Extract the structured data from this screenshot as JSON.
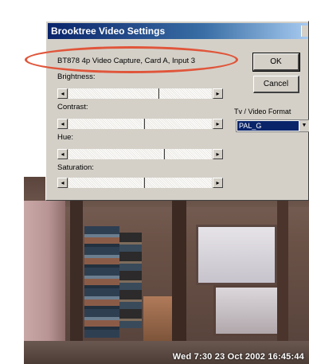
{
  "dialog": {
    "title": "Brooktree Video Settings",
    "device": "BT878 4p Video Capture, Card A, Input 3",
    "ok_label": "OK",
    "cancel_label": "Cancel",
    "format_label": "Tv / Video Format",
    "format_value": "PAL_G",
    "sliders": [
      {
        "label": "Brightness:",
        "value": 0.62
      },
      {
        "label": "Contrast:",
        "value": 0.52
      },
      {
        "label": "Hue:",
        "value": 0.66
      },
      {
        "label": "Saturation:",
        "value": 0.52
      }
    ]
  },
  "video": {
    "timestamp": "Wed 7:30 23 Oct 2002 16:45:44"
  }
}
